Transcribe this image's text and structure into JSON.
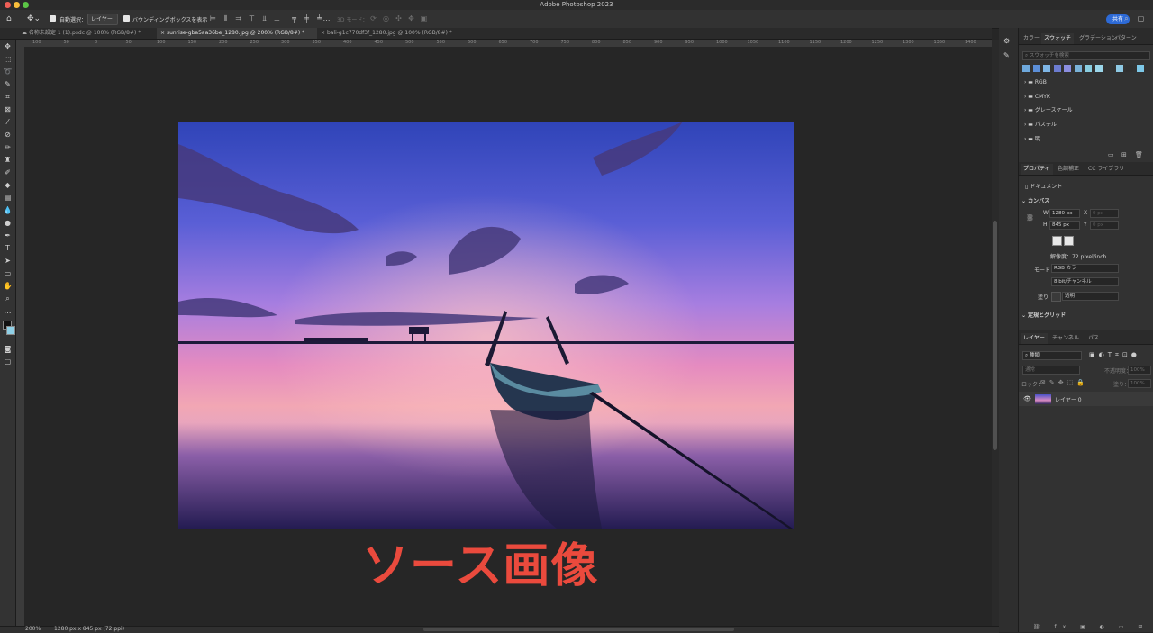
{
  "app": {
    "title": "Adobe Photoshop 2023",
    "share_label": "共有"
  },
  "options": {
    "auto_select_label": "自動選択：",
    "auto_select_target": "レイヤー",
    "bbox_label": "バウンディングボックスを表示",
    "mode3d_label": "3D モード："
  },
  "tabs": [
    {
      "label": "名称未設定 1 (1).psdc @ 100% (RGB/8#) *"
    },
    {
      "label": "sunrise-gba5aa36be_1280.jpg @ 200% (RGB/8#) *"
    },
    {
      "label": "bali-g1c770df3f_1280.jpg @ 100% (RGB/8#) *"
    }
  ],
  "ruler": [
    "100",
    "50",
    "0",
    "50",
    "100",
    "150",
    "200",
    "250",
    "300",
    "350",
    "400",
    "450",
    "500",
    "550",
    "600",
    "650",
    "700",
    "750",
    "800",
    "850",
    "900",
    "950",
    "1000",
    "1050",
    "1100",
    "1150",
    "1200",
    "1250",
    "1300",
    "1350",
    "1400"
  ],
  "canvas": {
    "caption": "ソース画像"
  },
  "status": {
    "zoom": "200%",
    "doc_info": "1280 px x 845 px (72 ppi)"
  },
  "swatches_panel": {
    "tabs": [
      "カラー",
      "スウォッチ",
      "グラデーション",
      "パターン"
    ],
    "search_placeholder": "スウォッチを検索",
    "swatch_colors": [
      "#6ea8dc",
      "#5c8fd8",
      "#7fb6e6",
      "#6c7cd0",
      "#8b8ee0",
      "#7ab2d8",
      "#89cde0",
      "#9bd6ea",
      "#333333",
      "#8ec9e4",
      "#303030",
      "#7dc8e8"
    ],
    "groups": [
      "RGB",
      "CMYK",
      "グレースケール",
      "パステル",
      "明"
    ]
  },
  "properties_panel": {
    "tabs": [
      "プロパティ",
      "色調補正",
      "CC ライブラリ"
    ],
    "section": "ドキュメント",
    "canvas_header": "カンバス",
    "w_label": "W",
    "w_value": "1280 px",
    "h_label": "H",
    "h_value": "845 px",
    "x_label": "X",
    "x_value": "0 px",
    "y_label": "Y",
    "y_value": "0 px",
    "resolution": "解像度：72 pixel/inch",
    "mode_label": "モード",
    "mode_value": "RGB カラー",
    "bit_value": "8 bit/チャンネル",
    "fill_label": "塗り",
    "fill_value": "透明",
    "guides_header": "定規とグリッド"
  },
  "layers_panel": {
    "tabs": [
      "レイヤー",
      "チャンネル",
      "パス"
    ],
    "filter_label": "種類",
    "blend_mode": "通常",
    "opacity_label": "不透明度：",
    "opacity_value": "100%",
    "lock_label": "ロック：",
    "fill_label": "塗り：",
    "fill_value": "100%",
    "layer_name": "レイヤー 0"
  }
}
